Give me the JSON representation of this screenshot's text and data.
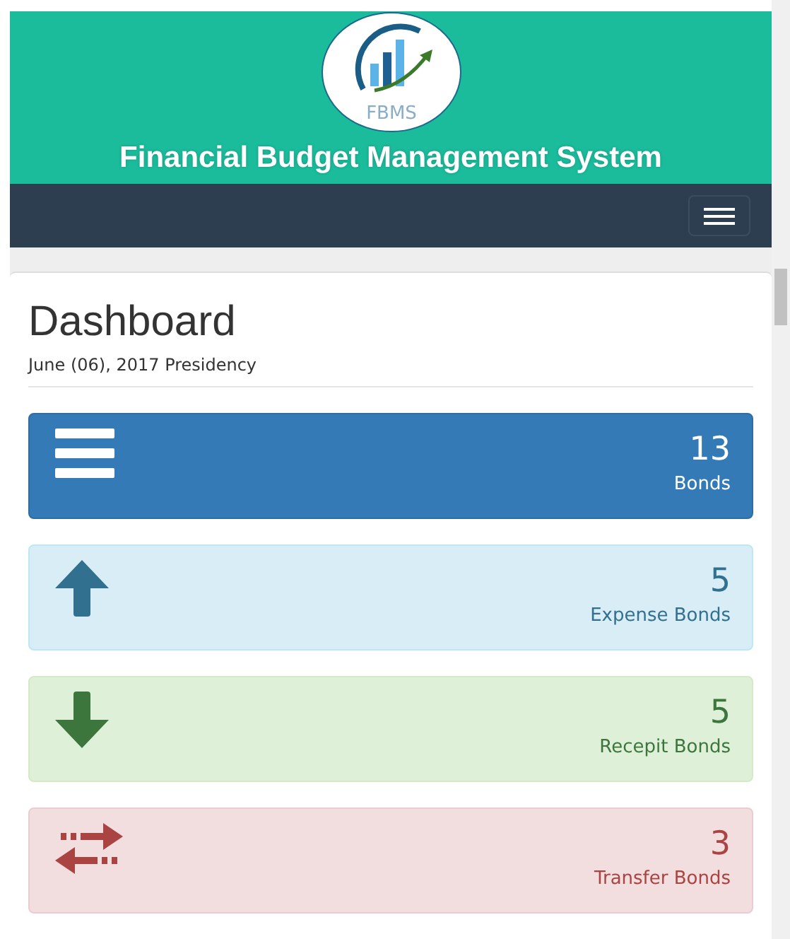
{
  "header": {
    "logo_text": "FBMS",
    "title": "Financial Budget Management System"
  },
  "page": {
    "title": "Dashboard",
    "subtitle": "June (06), 2017 Presidency"
  },
  "cards": [
    {
      "kind": "primary",
      "count": "13",
      "label": "Bonds"
    },
    {
      "kind": "info",
      "count": "5",
      "label": "Expense Bonds"
    },
    {
      "kind": "success",
      "count": "5",
      "label": "Recepit Bonds"
    },
    {
      "kind": "danger",
      "count": "3",
      "label": "Transfer Bonds"
    }
  ]
}
